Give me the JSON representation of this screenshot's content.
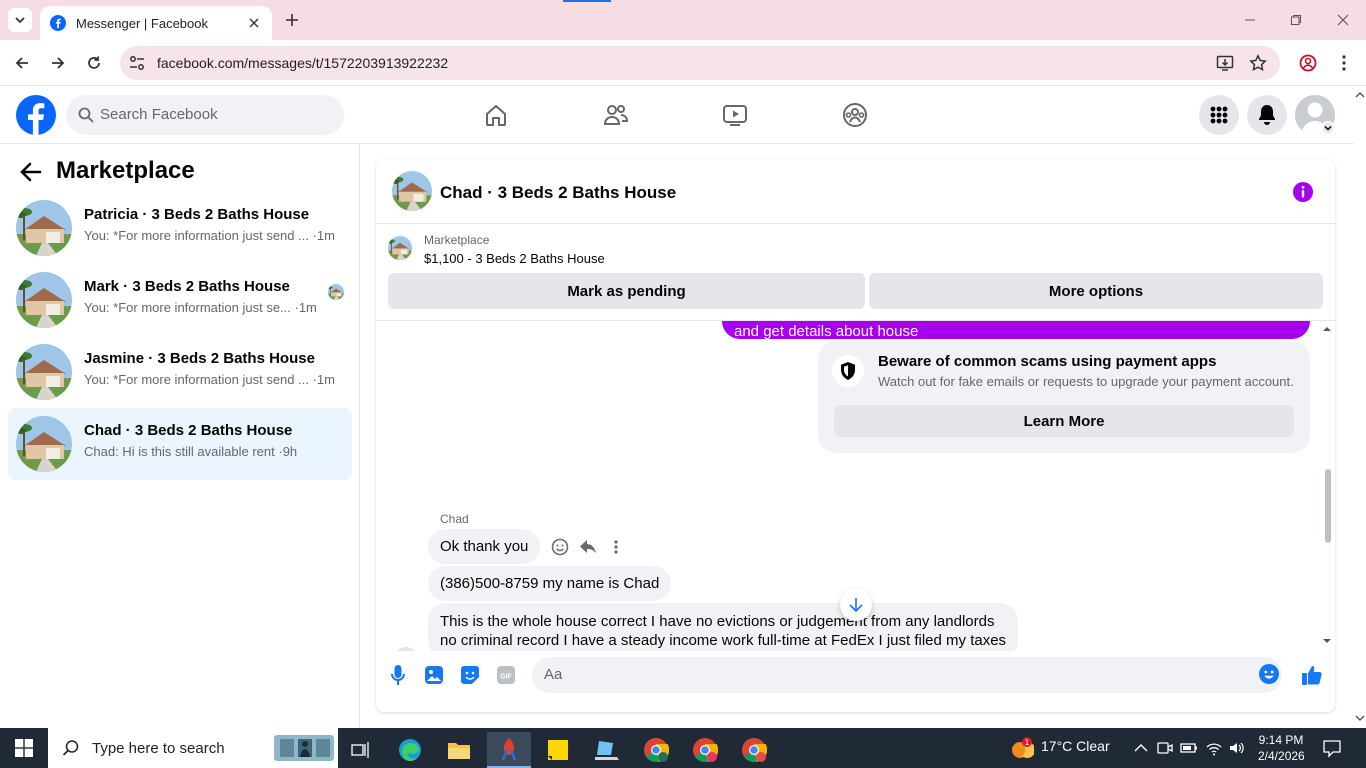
{
  "browser": {
    "tab_title": "Messenger | Facebook",
    "url": "facebook.com/messages/t/1572203913922232",
    "colors": {
      "tabstrip": "#f6dde4",
      "omnibox": "#f7e4ea"
    }
  },
  "fb": {
    "search_placeholder": "Search Facebook",
    "brand_color": "#0866ff"
  },
  "sidebar": {
    "title": "Marketplace",
    "conversations": [
      {
        "name": "Patricia · 3 Beds 2 Baths House",
        "snippet": "You: *For more information just send ... ·1m",
        "active": false
      },
      {
        "name": "Mark · 3 Beds 2 Baths House",
        "snippet": "You: *For more information just se... ·1m",
        "active": false
      },
      {
        "name": "Jasmine · 3 Beds 2 Baths House",
        "snippet": "You: *For more information just send ... ·1m",
        "active": false
      },
      {
        "name": "Chad · 3 Beds 2 Baths House",
        "snippet": "Chad: Hi is this still available rent ·9h",
        "active": true
      }
    ]
  },
  "chat": {
    "title": "Chad · 3 Beds 2 Baths House",
    "listing": {
      "source": "Marketplace",
      "title": "$1,100 - 3 Beds 2 Baths House",
      "buttons": [
        "Mark as pending",
        "More options"
      ]
    },
    "sent_partial": "and get details about house",
    "security": {
      "title": "Beware of common scams using payment apps",
      "subtitle": "Watch out for fake emails or requests to upgrade your payment account.",
      "button": "Learn More"
    },
    "sender": "Chad",
    "messages": [
      "Ok thank you",
      "(386)500-8759 my name is Chad",
      "This is the whole house correct I have no evictions or judgement from any landlords",
      "no criminal record I have a steady income work full-time at FedEx I just filed my taxes"
    ],
    "composer_placeholder": "Aa",
    "accent_color": "#a601ef"
  },
  "taskbar": {
    "search_placeholder": "Type here to search",
    "weather": "17°C  Clear",
    "weather_badge": "1",
    "time": "9:14 PM",
    "date": "2/4/2026"
  }
}
